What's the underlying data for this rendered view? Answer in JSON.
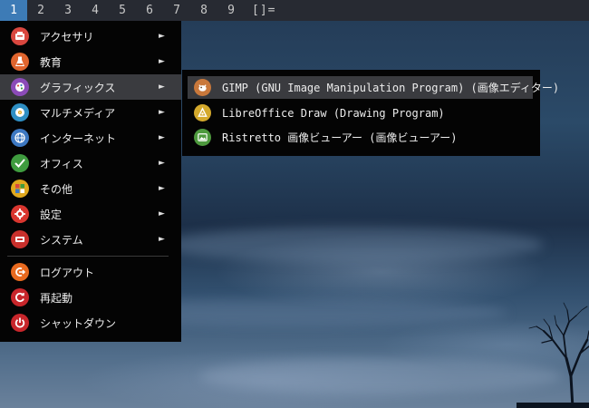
{
  "topbar": {
    "workspaces": [
      "1",
      "2",
      "3",
      "4",
      "5",
      "6",
      "7",
      "8",
      "9"
    ],
    "active_workspace": "1",
    "layout_indicator": "[]="
  },
  "menu": {
    "items": [
      {
        "label": "アクセサリ",
        "icon": "accessories-icon",
        "color": "#d9473f",
        "submenu": true
      },
      {
        "label": "教育",
        "icon": "education-flask-icon",
        "color": "#e0652e",
        "submenu": true
      },
      {
        "label": "グラフィックス",
        "icon": "graphics-icon",
        "color": "#8b4bb8",
        "submenu": true,
        "selected": true
      },
      {
        "label": "マルチメディア",
        "icon": "multimedia-icon",
        "color": "#2f8fc4",
        "submenu": true
      },
      {
        "label": "インターネット",
        "icon": "internet-globe-icon",
        "color": "#3d78c2",
        "submenu": true
      },
      {
        "label": "オフィス",
        "icon": "office-check-icon",
        "color": "#3f9c3f",
        "submenu": true
      },
      {
        "label": "その他",
        "icon": "other-grid-icon",
        "color": "#e0a81e",
        "submenu": true
      },
      {
        "label": "設定",
        "icon": "settings-gear-icon",
        "color": "#d9362f",
        "submenu": true
      },
      {
        "label": "システム",
        "icon": "system-icon",
        "color": "#c9302c",
        "submenu": true
      }
    ],
    "session": [
      {
        "label": "ログアウト",
        "icon": "logout-icon",
        "color": "#e86a1f"
      },
      {
        "label": "再起動",
        "icon": "reboot-icon",
        "color": "#c8262b"
      },
      {
        "label": "シャットダウン",
        "icon": "shutdown-icon",
        "color": "#c8262b"
      }
    ],
    "arrow": "►"
  },
  "submenu": {
    "items": [
      {
        "label": "GIMP (GNU Image Manipulation Program) (画像エディター)",
        "icon": "gimp-icon",
        "color": "#c9783b",
        "selected": true
      },
      {
        "label": "LibreOffice Draw (Drawing Program)",
        "icon": "libreoffice-draw-icon",
        "color": "#d4a92c"
      },
      {
        "label": "Ristretto 画像ビューアー (画像ビューアー)",
        "icon": "ristretto-icon",
        "color": "#4e9a3e"
      }
    ]
  }
}
